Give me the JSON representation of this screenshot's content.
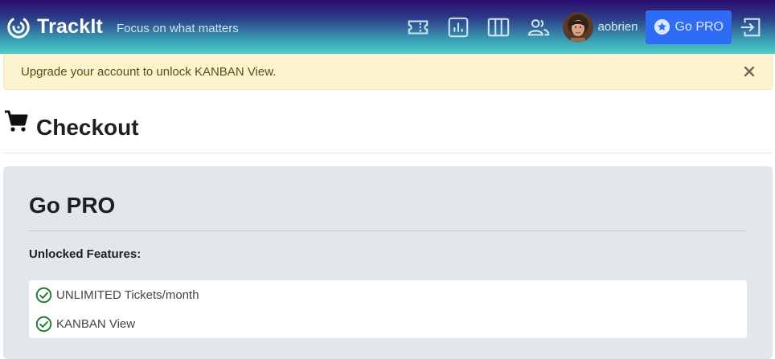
{
  "header": {
    "brand": "TrackIt",
    "tagline": "Focus on what matters",
    "username": "aobrien",
    "go_pro_label": "Go PRO",
    "icons": [
      "ticket-icon",
      "chart-icon",
      "kanban-icon",
      "people-icon",
      "logout-icon"
    ]
  },
  "alert": {
    "message": "Upgrade your account to unlock KANBAN View."
  },
  "page": {
    "title": "Checkout"
  },
  "card": {
    "title": "Go PRO",
    "features_label": "Unlocked Features:",
    "features": [
      "UNLIMITED Tickets/month",
      "KANBAN View"
    ]
  },
  "colors": {
    "go_pro_button": "#2f6cf5",
    "alert_background": "#fcf3cf",
    "check_green": "#1d7a2e",
    "card_background": "#e3e6ea"
  }
}
